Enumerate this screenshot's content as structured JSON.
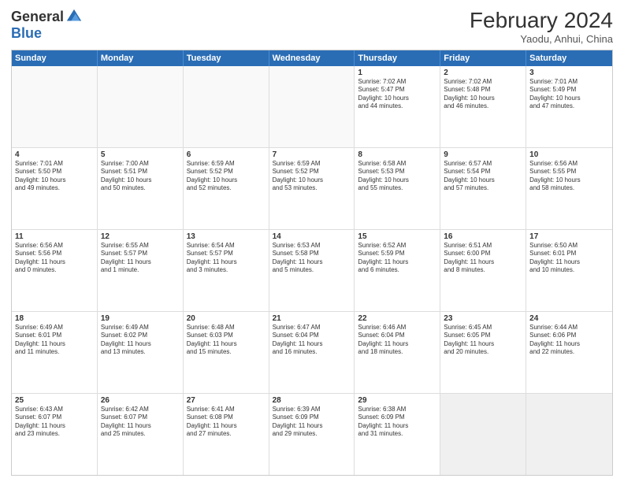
{
  "logo": {
    "general": "General",
    "blue": "Blue"
  },
  "title": "February 2024",
  "subtitle": "Yaodu, Anhui, China",
  "header_days": [
    "Sunday",
    "Monday",
    "Tuesday",
    "Wednesday",
    "Thursday",
    "Friday",
    "Saturday"
  ],
  "weeks": [
    [
      {
        "day": "",
        "info": ""
      },
      {
        "day": "",
        "info": ""
      },
      {
        "day": "",
        "info": ""
      },
      {
        "day": "",
        "info": ""
      },
      {
        "day": "1",
        "info": "Sunrise: 7:02 AM\nSunset: 5:47 PM\nDaylight: 10 hours\nand 44 minutes."
      },
      {
        "day": "2",
        "info": "Sunrise: 7:02 AM\nSunset: 5:48 PM\nDaylight: 10 hours\nand 46 minutes."
      },
      {
        "day": "3",
        "info": "Sunrise: 7:01 AM\nSunset: 5:49 PM\nDaylight: 10 hours\nand 47 minutes."
      }
    ],
    [
      {
        "day": "4",
        "info": "Sunrise: 7:01 AM\nSunset: 5:50 PM\nDaylight: 10 hours\nand 49 minutes."
      },
      {
        "day": "5",
        "info": "Sunrise: 7:00 AM\nSunset: 5:51 PM\nDaylight: 10 hours\nand 50 minutes."
      },
      {
        "day": "6",
        "info": "Sunrise: 6:59 AM\nSunset: 5:52 PM\nDaylight: 10 hours\nand 52 minutes."
      },
      {
        "day": "7",
        "info": "Sunrise: 6:59 AM\nSunset: 5:52 PM\nDaylight: 10 hours\nand 53 minutes."
      },
      {
        "day": "8",
        "info": "Sunrise: 6:58 AM\nSunset: 5:53 PM\nDaylight: 10 hours\nand 55 minutes."
      },
      {
        "day": "9",
        "info": "Sunrise: 6:57 AM\nSunset: 5:54 PM\nDaylight: 10 hours\nand 57 minutes."
      },
      {
        "day": "10",
        "info": "Sunrise: 6:56 AM\nSunset: 5:55 PM\nDaylight: 10 hours\nand 58 minutes."
      }
    ],
    [
      {
        "day": "11",
        "info": "Sunrise: 6:56 AM\nSunset: 5:56 PM\nDaylight: 11 hours\nand 0 minutes."
      },
      {
        "day": "12",
        "info": "Sunrise: 6:55 AM\nSunset: 5:57 PM\nDaylight: 11 hours\nand 1 minute."
      },
      {
        "day": "13",
        "info": "Sunrise: 6:54 AM\nSunset: 5:57 PM\nDaylight: 11 hours\nand 3 minutes."
      },
      {
        "day": "14",
        "info": "Sunrise: 6:53 AM\nSunset: 5:58 PM\nDaylight: 11 hours\nand 5 minutes."
      },
      {
        "day": "15",
        "info": "Sunrise: 6:52 AM\nSunset: 5:59 PM\nDaylight: 11 hours\nand 6 minutes."
      },
      {
        "day": "16",
        "info": "Sunrise: 6:51 AM\nSunset: 6:00 PM\nDaylight: 11 hours\nand 8 minutes."
      },
      {
        "day": "17",
        "info": "Sunrise: 6:50 AM\nSunset: 6:01 PM\nDaylight: 11 hours\nand 10 minutes."
      }
    ],
    [
      {
        "day": "18",
        "info": "Sunrise: 6:49 AM\nSunset: 6:01 PM\nDaylight: 11 hours\nand 11 minutes."
      },
      {
        "day": "19",
        "info": "Sunrise: 6:49 AM\nSunset: 6:02 PM\nDaylight: 11 hours\nand 13 minutes."
      },
      {
        "day": "20",
        "info": "Sunrise: 6:48 AM\nSunset: 6:03 PM\nDaylight: 11 hours\nand 15 minutes."
      },
      {
        "day": "21",
        "info": "Sunrise: 6:47 AM\nSunset: 6:04 PM\nDaylight: 11 hours\nand 16 minutes."
      },
      {
        "day": "22",
        "info": "Sunrise: 6:46 AM\nSunset: 6:04 PM\nDaylight: 11 hours\nand 18 minutes."
      },
      {
        "day": "23",
        "info": "Sunrise: 6:45 AM\nSunset: 6:05 PM\nDaylight: 11 hours\nand 20 minutes."
      },
      {
        "day": "24",
        "info": "Sunrise: 6:44 AM\nSunset: 6:06 PM\nDaylight: 11 hours\nand 22 minutes."
      }
    ],
    [
      {
        "day": "25",
        "info": "Sunrise: 6:43 AM\nSunset: 6:07 PM\nDaylight: 11 hours\nand 23 minutes."
      },
      {
        "day": "26",
        "info": "Sunrise: 6:42 AM\nSunset: 6:07 PM\nDaylight: 11 hours\nand 25 minutes."
      },
      {
        "day": "27",
        "info": "Sunrise: 6:41 AM\nSunset: 6:08 PM\nDaylight: 11 hours\nand 27 minutes."
      },
      {
        "day": "28",
        "info": "Sunrise: 6:39 AM\nSunset: 6:09 PM\nDaylight: 11 hours\nand 29 minutes."
      },
      {
        "day": "29",
        "info": "Sunrise: 6:38 AM\nSunset: 6:09 PM\nDaylight: 11 hours\nand 31 minutes."
      },
      {
        "day": "",
        "info": ""
      },
      {
        "day": "",
        "info": ""
      }
    ]
  ]
}
